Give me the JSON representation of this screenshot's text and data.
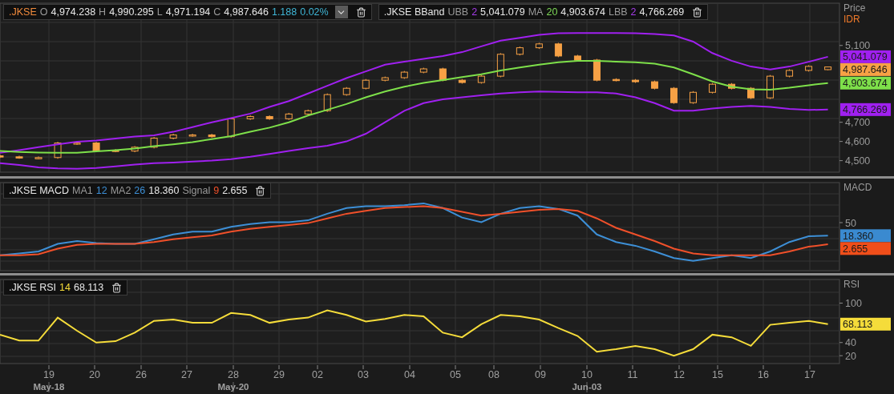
{
  "price_panel": {
    "legends": [
      {
        "dropdown": true,
        "items": [
          {
            "kind": "symbol",
            "text": ".JKSE"
          },
          {
            "kind": "key",
            "text": "O"
          },
          {
            "kind": "value",
            "text": "4,974.238"
          },
          {
            "kind": "key",
            "text": "H"
          },
          {
            "kind": "value",
            "text": "4,990.295"
          },
          {
            "kind": "key",
            "text": "L"
          },
          {
            "kind": "value",
            "text": "4,971.194"
          },
          {
            "kind": "key",
            "text": "C"
          },
          {
            "kind": "value",
            "text": "4,987.646"
          },
          {
            "kind": "change",
            "text": "1.188"
          },
          {
            "kind": "change",
            "text": "0.02%"
          }
        ]
      },
      {
        "dropdown": false,
        "items": [
          {
            "kind": "value",
            "text": ".JKSE BBand"
          },
          {
            "kind": "key",
            "text": "UBB"
          },
          {
            "kind": "param",
            "text": "2",
            "color": "#a43be8"
          },
          {
            "kind": "value",
            "text": "5,041.079"
          },
          {
            "kind": "key",
            "text": "MA"
          },
          {
            "kind": "param",
            "text": "20",
            "color": "#7ed957"
          },
          {
            "kind": "value",
            "text": "4,903.674"
          },
          {
            "kind": "key",
            "text": "LBB"
          },
          {
            "kind": "param",
            "text": "2",
            "color": "#a43be8"
          },
          {
            "kind": "value",
            "text": "4,766.269"
          }
        ]
      }
    ],
    "axis_title": "Price",
    "axis_unit": "IDR",
    "value_labels": [
      {
        "text": "5,041.079",
        "color": "#a020f0"
      },
      {
        "text": "4,987.646",
        "color": "#f7a145"
      },
      {
        "text": "4,903.674",
        "color": "#7ee04a"
      },
      {
        "text": "4,766.269",
        "color": "#a020f0"
      }
    ],
    "chart_data": {
      "type": "candlestick",
      "grid": true,
      "ylim": [
        4440,
        5320
      ],
      "yticks": [
        {
          "value": 4500,
          "label": "4,500"
        },
        {
          "value": 4600,
          "label": "4,600"
        },
        {
          "value": 4700,
          "label": "4,700"
        },
        {
          "value": 5100,
          "label": "5,100"
        }
      ],
      "categories": [
        null,
        null,
        null,
        null,
        null,
        null,
        null,
        null,
        null,
        null,
        null,
        null,
        null,
        null,
        null,
        null,
        null,
        null,
        null,
        null,
        null,
        null,
        null,
        null,
        null,
        null,
        null,
        null,
        null,
        null,
        null,
        null,
        null,
        null,
        null,
        null,
        null,
        null,
        null,
        null,
        null,
        null,
        null,
        null
      ],
      "series": [
        {
          "type": "line",
          "color": "#a020f0",
          "values": [
            4541,
            4555,
            4570,
            4585,
            4598,
            4605,
            4615,
            4625,
            4632,
            4650,
            4675,
            4700,
            4722,
            4745,
            4780,
            4810,
            4850,
            4890,
            4930,
            4965,
            5000,
            5015,
            5030,
            5045,
            5065,
            5095,
            5125,
            5140,
            5155,
            5163,
            5165,
            5165,
            5165,
            5163,
            5160,
            5152,
            5120,
            5060,
            5020,
            4990,
            4975,
            4990,
            5015,
            5041
          ]
        },
        {
          "type": "line",
          "color": "#7ee04a",
          "values": [
            4550,
            4545,
            4542,
            4541,
            4541,
            4548,
            4555,
            4563,
            4575,
            4585,
            4597,
            4612,
            4628,
            4650,
            4672,
            4700,
            4735,
            4765,
            4795,
            4830,
            4860,
            4885,
            4905,
            4920,
            4935,
            4950,
            4970,
            4985,
            5000,
            5012,
            5020,
            5020,
            5016,
            5012,
            5005,
            4985,
            4950,
            4912,
            4885,
            4872,
            4870,
            4880,
            4893,
            4904
          ]
        },
        {
          "type": "line",
          "color": "#a020f0",
          "values": [
            4487,
            4478,
            4465,
            4460,
            4458,
            4462,
            4470,
            4480,
            4487,
            4490,
            4495,
            4500,
            4508,
            4520,
            4535,
            4550,
            4565,
            4578,
            4600,
            4640,
            4700,
            4760,
            4800,
            4820,
            4830,
            4840,
            4850,
            4856,
            4860,
            4858,
            4856,
            4856,
            4850,
            4830,
            4800,
            4760,
            4760,
            4772,
            4780,
            4785,
            4780,
            4770,
            4764,
            4766
          ]
        }
      ],
      "ohlc": [
        [
          4525,
          4531,
          4514,
          4520
        ],
        [
          4520,
          4526,
          4510,
          4516
        ],
        [
          4512,
          4522,
          4508,
          4516
        ],
        [
          4516,
          4598,
          4510,
          4592
        ],
        [
          4588,
          4598,
          4582,
          4592
        ],
        [
          4592,
          4598,
          4544,
          4550
        ],
        [
          4554,
          4560,
          4544,
          4550
        ],
        [
          4550,
          4576,
          4544,
          4570
        ],
        [
          4570,
          4623,
          4564,
          4617
        ],
        [
          4617,
          4640,
          4611,
          4634
        ],
        [
          4630,
          4640,
          4624,
          4634
        ],
        [
          4634,
          4640,
          4619,
          4625
        ],
        [
          4625,
          4724,
          4619,
          4718
        ],
        [
          4718,
          4736,
          4712,
          4730
        ],
        [
          4730,
          4736,
          4712,
          4718
        ],
        [
          4718,
          4749,
          4712,
          4743
        ],
        [
          4743,
          4766,
          4737,
          4760
        ],
        [
          4760,
          4850,
          4754,
          4844
        ],
        [
          4844,
          4883,
          4838,
          4877
        ],
        [
          4877,
          4925,
          4871,
          4919
        ],
        [
          4919,
          4938,
          4913,
          4932
        ],
        [
          4932,
          4967,
          4926,
          4961
        ],
        [
          4961,
          4984,
          4955,
          4978
        ],
        [
          4978,
          4984,
          4913,
          4919
        ],
        [
          4919,
          4925,
          4901,
          4907
        ],
        [
          4907,
          4946,
          4901,
          4940
        ],
        [
          4940,
          5060,
          4934,
          5054
        ],
        [
          5054,
          5094,
          5048,
          5088
        ],
        [
          5088,
          5114,
          5082,
          5108
        ],
        [
          5108,
          5114,
          5039,
          5045
        ],
        [
          5045,
          5051,
          5018,
          5024
        ],
        [
          5024,
          5030,
          4913,
          4919
        ],
        [
          4923,
          4929,
          4913,
          4919
        ],
        [
          4919,
          4925,
          4905,
          4911
        ],
        [
          4911,
          4917,
          4871,
          4877
        ],
        [
          4877,
          4883,
          4796,
          4802
        ],
        [
          4802,
          4862,
          4796,
          4856
        ],
        [
          4856,
          4904,
          4850,
          4898
        ],
        [
          4898,
          4904,
          4871,
          4877
        ],
        [
          4877,
          4883,
          4821,
          4827
        ],
        [
          4827,
          4946,
          4821,
          4940
        ],
        [
          4940,
          4976,
          4934,
          4970
        ],
        [
          4970,
          4997,
          4964,
          4991
        ],
        [
          4974,
          4990,
          4971,
          4988
        ]
      ]
    }
  },
  "macd_panel": {
    "legends": [
      {
        "dropdown": false,
        "items": [
          {
            "kind": "value",
            "text": ".JKSE MACD"
          },
          {
            "kind": "key",
            "text": "MA1"
          },
          {
            "kind": "param",
            "text": "12",
            "color": "#3d8fd6"
          },
          {
            "kind": "key",
            "text": "MA2"
          },
          {
            "kind": "param",
            "text": "26",
            "color": "#3d8fd6"
          },
          {
            "kind": "value",
            "text": "18.360"
          },
          {
            "kind": "key",
            "text": "Signal"
          },
          {
            "kind": "param",
            "text": "9",
            "color": "#f0502a"
          },
          {
            "kind": "value",
            "text": "2.655"
          }
        ]
      }
    ],
    "axis_title": "MACD",
    "value_labels": [
      {
        "text": "18.360",
        "color": "#3a8ad0"
      },
      {
        "text": "2.655",
        "color": "#f04e1a"
      }
    ],
    "axis_tick": "50"
  },
  "rsi_panel": {
    "legends": [
      {
        "dropdown": false,
        "items": [
          {
            "kind": "value",
            "text": ".JKSE RSI"
          },
          {
            "kind": "param",
            "text": "14",
            "color": "#f5dc3a"
          },
          {
            "kind": "value",
            "text": "68.113"
          }
        ]
      }
    ],
    "axis_title": "RSI",
    "value_labels": [
      {
        "text": "68.113",
        "color": "#f5dc3a"
      }
    ],
    "chart_data": {
      "type": "line",
      "grid": true,
      "ylim": [
        8,
        136
      ],
      "yticks": [
        20,
        40,
        100
      ],
      "categories": [
        null,
        null,
        null,
        null,
        null,
        null,
        null,
        null,
        null,
        null,
        null,
        null,
        null,
        null,
        null,
        null,
        null,
        null,
        null,
        null,
        null,
        null,
        null,
        null,
        null,
        null,
        null,
        null,
        null,
        null,
        null,
        null,
        null,
        null,
        null,
        null,
        null,
        null,
        null,
        null,
        null,
        null,
        null,
        null
      ],
      "series": [
        {
          "color": "#f5dc3a",
          "values": [
            52,
            43,
            43,
            78,
            58,
            40,
            42,
            55,
            73,
            75,
            70,
            70,
            85,
            82,
            70,
            75,
            78,
            89,
            82,
            72,
            76,
            82,
            80,
            55,
            48,
            68,
            82,
            80,
            75,
            62,
            50,
            26,
            30,
            35,
            30,
            20,
            30,
            52,
            48,
            35,
            67,
            70,
            73,
            68
          ]
        }
      ]
    }
  },
  "time_axis": [
    {
      "label": "19",
      "month": "May-18"
    },
    {
      "label": "20"
    },
    {
      "label": "26"
    },
    {
      "label": "27"
    },
    {
      "label": "28",
      "month": "May-20"
    },
    {
      "label": "29"
    },
    {
      "label": "02"
    },
    {
      "label": "03"
    },
    {
      "label": "04"
    },
    {
      "label": "05"
    },
    {
      "label": "08"
    },
    {
      "label": "09"
    },
    {
      "label": "10",
      "month": "Jun-03"
    },
    {
      "label": "11"
    },
    {
      "label": "12"
    },
    {
      "label": "15"
    },
    {
      "label": "16"
    },
    {
      "label": "17"
    }
  ]
}
